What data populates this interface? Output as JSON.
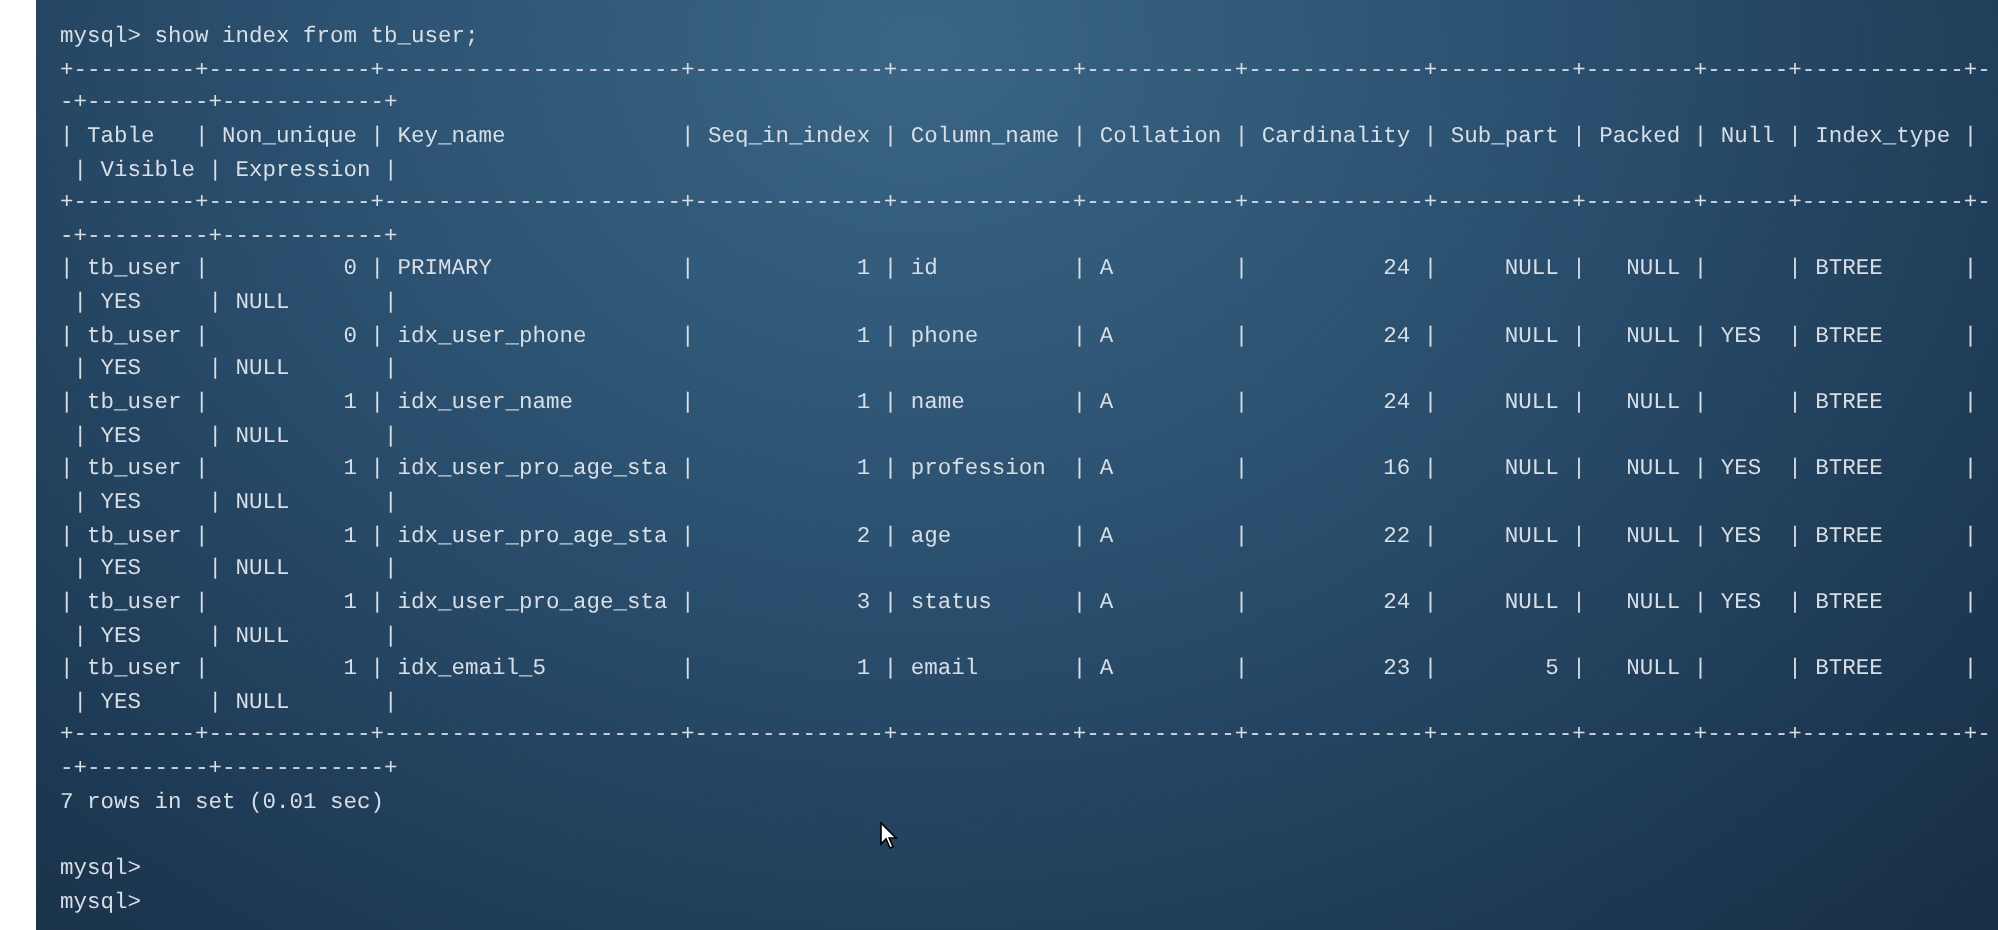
{
  "terminal": {
    "output_lines": [
      "mysql> show index from tb_user;",
      "+---------+------------+----------------------+--------------+-------------+-----------+-------------+----------+--------+------+------------+-",
      "-+---------+------------+",
      "| Table   | Non_unique | Key_name             | Seq_in_index | Column_name | Collation | Cardinality | Sub_part | Packed | Null | Index_type |",
      " | Visible | Expression |",
      "+---------+------------+----------------------+--------------+-------------+-----------+-------------+----------+--------+------+------------+-",
      "-+---------+------------+",
      "| tb_user |          0 | PRIMARY              |            1 | id          | A         |          24 |     NULL |   NULL |      | BTREE      |",
      " | YES     | NULL       |",
      "| tb_user |          0 | idx_user_phone       |            1 | phone       | A         |          24 |     NULL |   NULL | YES  | BTREE      |",
      " | YES     | NULL       |",
      "| tb_user |          1 | idx_user_name        |            1 | name        | A         |          24 |     NULL |   NULL |      | BTREE      |",
      " | YES     | NULL       |",
      "| tb_user |          1 | idx_user_pro_age_sta |            1 | profession  | A         |          16 |     NULL |   NULL | YES  | BTREE      |",
      " | YES     | NULL       |",
      "| tb_user |          1 | idx_user_pro_age_sta |            2 | age         | A         |          22 |     NULL |   NULL | YES  | BTREE      |",
      " | YES     | NULL       |",
      "| tb_user |          1 | idx_user_pro_age_sta |            3 | status      | A         |          24 |     NULL |   NULL | YES  | BTREE      |",
      " | YES     | NULL       |",
      "| tb_user |          1 | idx_email_5          |            1 | email       | A         |          23 |        5 |   NULL |      | BTREE      |",
      " | YES     | NULL       |",
      "+---------+------------+----------------------+--------------+-------------+-----------+-------------+----------+--------+------+------------+-",
      "-+---------+------------+",
      "7 rows in set (0.01 sec)"
    ],
    "prompt_lines": [
      "mysql>",
      "mysql>"
    ]
  }
}
